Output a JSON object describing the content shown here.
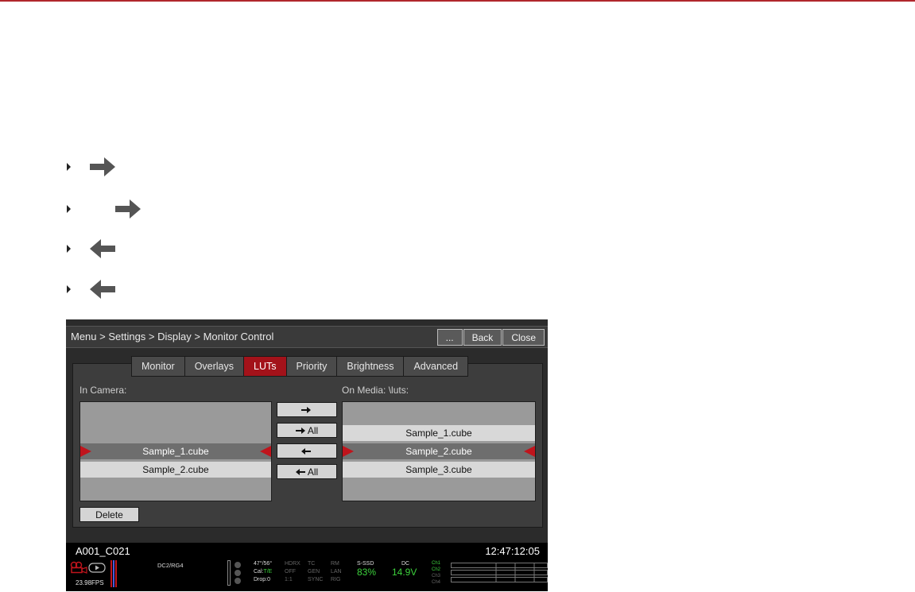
{
  "menu": {
    "breadcrumb": "Menu > Settings > Display > Monitor Control",
    "more_label": "...",
    "back_label": "Back",
    "close_label": "Close"
  },
  "tabs": [
    {
      "label": "Monitor"
    },
    {
      "label": "Overlays"
    },
    {
      "label": "LUTs"
    },
    {
      "label": "Priority"
    },
    {
      "label": "Brightness"
    },
    {
      "label": "Advanced"
    }
  ],
  "active_tab": "LUTs",
  "in_camera": {
    "label": "In Camera:",
    "items": [
      "Sample_1.cube",
      "Sample_2.cube"
    ],
    "selected": "Sample_1.cube"
  },
  "on_media": {
    "label": "On Media: \\luts:",
    "items": [
      "Sample_1.cube",
      "Sample_2.cube",
      "Sample_3.cube"
    ],
    "selected": "Sample_2.cube"
  },
  "transfer_buttons": {
    "copy_to_media": "",
    "copy_all_to_media": "All",
    "copy_to_camera": "",
    "copy_all_to_camera": "All"
  },
  "delete_label": "Delete",
  "clip": {
    "name": "A001_C021",
    "timecode": "12:47:12:05"
  },
  "status": {
    "fps": "23.98FPS",
    "resolution": "DC2/RG4",
    "temp": "47°/56°",
    "cal_label": "Cal:",
    "cal_value": "T/E",
    "drop": "Drop:0",
    "hdrx": "HDRX",
    "hdrx_value": "OFF",
    "aspect": "1:1",
    "tc": "TC",
    "tc_value": "GEN",
    "sync": "SYNC",
    "rm": "RM",
    "rm_value": "LAN",
    "rig": "RIG",
    "media": "S-SSD",
    "media_pct": "83%",
    "power": "DC",
    "voltage": "14.9V",
    "channels": [
      "Ch1",
      "Ch2",
      "Ch3",
      "Ch4"
    ]
  },
  "colors": {
    "accent": "#a3121a",
    "brand_rule": "#b0262c",
    "status_green": "#3cd13c"
  },
  "icons": {
    "legend": [
      "arrow-right-icon",
      "arrow-right-all-icon",
      "arrow-left-icon",
      "arrow-left-all-icon"
    ]
  }
}
